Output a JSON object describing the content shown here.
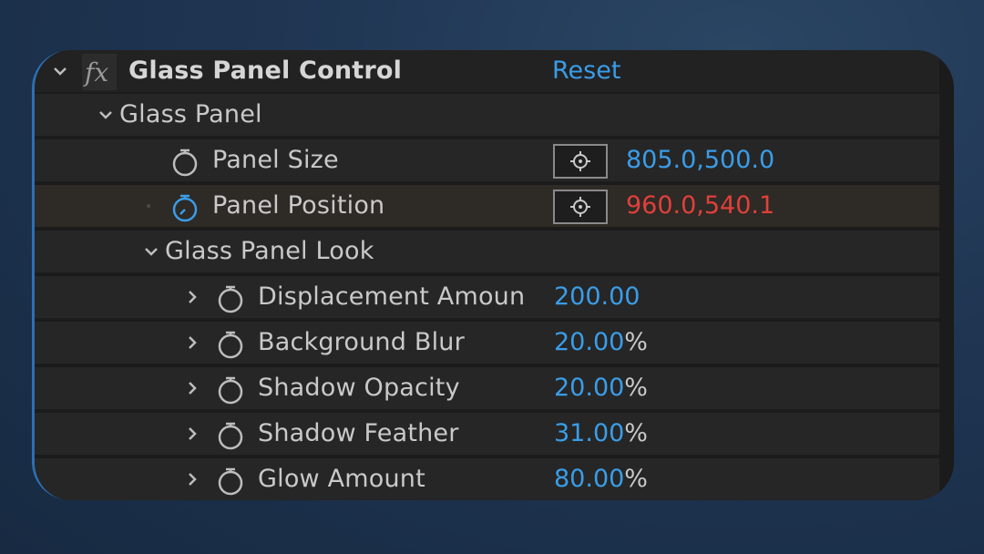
{
  "effect": {
    "name": "Glass Panel Control",
    "reset_label": "Reset"
  },
  "groups": [
    {
      "label": "Glass Panel",
      "properties": [
        {
          "label": "Panel Size",
          "value": "805.0,500.0",
          "value_color": "#3a9de8",
          "stopwatch_active": false
        },
        {
          "label": "Panel Position",
          "value": "960.0,540.1",
          "value_color": "#e0403a",
          "stopwatch_active": true
        }
      ]
    },
    {
      "label": "Glass Panel Look",
      "properties": [
        {
          "label": "Displacement Amoun",
          "value": "200.00",
          "unit": ""
        },
        {
          "label": "Background Blur",
          "value": "20.00",
          "unit": "%"
        },
        {
          "label": "Shadow Opacity",
          "value": "20.00",
          "unit": "%"
        },
        {
          "label": "Shadow Feather",
          "value": "31.00",
          "unit": "%"
        },
        {
          "label": "Glow Amount",
          "value": "80.00",
          "unit": "%"
        }
      ]
    }
  ],
  "colors": {
    "accent": "#3a9de8",
    "keyframed_value": "#e0403a",
    "stopwatch_active": "#3a9de8"
  },
  "icons": {
    "collapse": "chevron-down-icon",
    "expand": "chevron-right-icon",
    "effect": "fx-icon",
    "stopwatch": "stopwatch-icon",
    "point_control": "crosshair-target-icon"
  }
}
